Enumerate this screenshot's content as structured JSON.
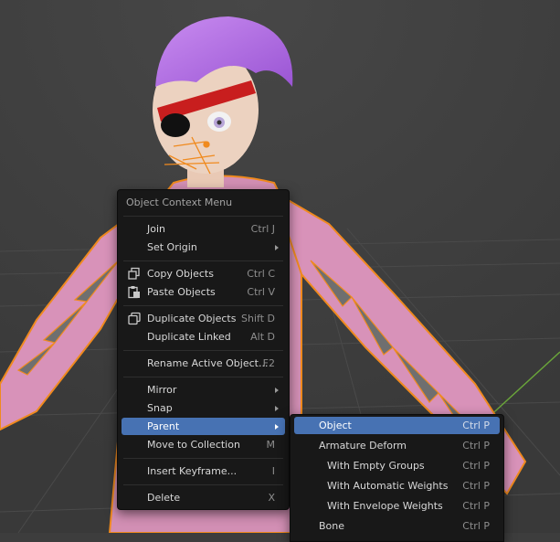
{
  "context_menu": {
    "title": "Object Context Menu",
    "items": [
      {
        "label": "Join",
        "shortcut": "Ctrl J"
      },
      {
        "label": "Set Origin",
        "shortcut": ""
      },
      {
        "label": "Copy Objects",
        "shortcut": "Ctrl C"
      },
      {
        "label": "Paste Objects",
        "shortcut": "Ctrl V"
      },
      {
        "label": "Duplicate Objects",
        "shortcut": "Shift D"
      },
      {
        "label": "Duplicate Linked",
        "shortcut": "Alt D"
      },
      {
        "label": "Rename Active Object...",
        "shortcut": "F2"
      },
      {
        "label": "Mirror",
        "shortcut": ""
      },
      {
        "label": "Snap",
        "shortcut": ""
      },
      {
        "label": "Parent",
        "shortcut": ""
      },
      {
        "label": "Move to Collection",
        "shortcut": "M"
      },
      {
        "label": "Insert Keyframe...",
        "shortcut": "I"
      },
      {
        "label": "Delete",
        "shortcut": "X"
      }
    ]
  },
  "parent_submenu": {
    "items": [
      {
        "label": "Object",
        "shortcut": "Ctrl P"
      },
      {
        "label": "Armature Deform",
        "shortcut": "Ctrl P"
      },
      {
        "label": "With Empty Groups",
        "shortcut": "Ctrl P"
      },
      {
        "label": "With Automatic Weights",
        "shortcut": "Ctrl P"
      },
      {
        "label": "With Envelope Weights",
        "shortcut": "Ctrl P"
      },
      {
        "label": "Bone",
        "shortcut": "Ctrl P"
      }
    ]
  },
  "colors": {
    "viewport_bg": "#3d3d3d",
    "menu_bg": "#181818",
    "highlight": "#4772b3",
    "selection_outline": "#f08a1e"
  },
  "icons": {
    "copy": "copy-icon",
    "paste": "paste-icon",
    "duplicate": "duplicate-icon"
  }
}
